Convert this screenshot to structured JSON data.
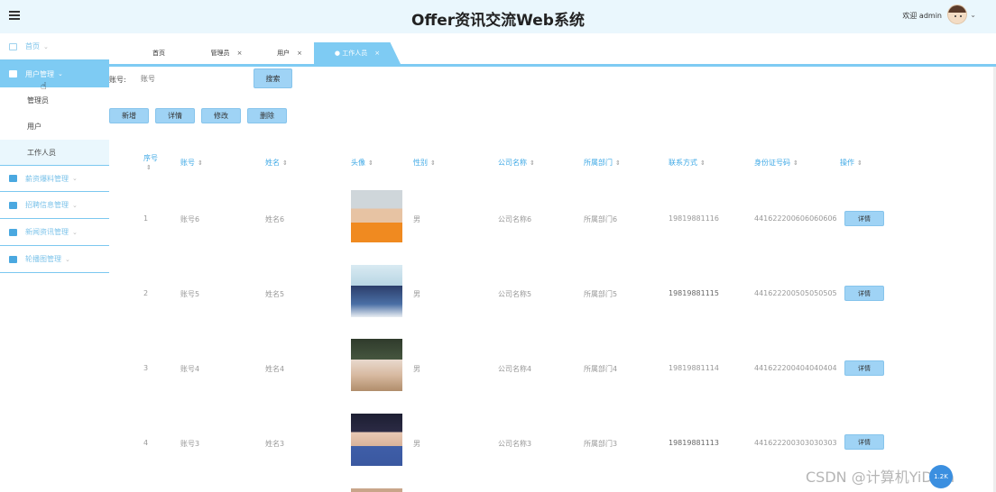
{
  "header": {
    "title": "Offer资讯交流Web系统",
    "welcome": "欢迎 admin",
    "caret": "⌄"
  },
  "sidebar": {
    "items": [
      {
        "label": "首页"
      },
      {
        "label": "用户管理"
      },
      {
        "label": "薪资爆料管理"
      },
      {
        "label": "招聘信息管理"
      },
      {
        "label": "新闻资讯管理"
      },
      {
        "label": "轮播图管理"
      }
    ],
    "sub_items": [
      {
        "label": "管理员"
      },
      {
        "label": "用户"
      },
      {
        "label": "工作人员"
      }
    ]
  },
  "tabs": [
    {
      "label": "首页",
      "close": ""
    },
    {
      "label": "管理员",
      "close": "×"
    },
    {
      "label": "用户",
      "close": "×"
    },
    {
      "label": "● 工作人员",
      "close": "×"
    }
  ],
  "search": {
    "label": "账号:",
    "placeholder": "账号",
    "button": "搜索"
  },
  "toolbar": {
    "add": "新增",
    "detail": "详情",
    "edit": "修改",
    "delete": "删除"
  },
  "table": {
    "headers": [
      "序号",
      "账号",
      "姓名",
      "头像",
      "性别",
      "公司名称",
      "所属部门",
      "联系方式",
      "身份证号码",
      "操作"
    ],
    "sort_glyph": "⇕",
    "rows": [
      {
        "no": "1",
        "account": "账号6",
        "name": "姓名6",
        "gender": "男",
        "company": "公司名称6",
        "dept": "所属部门6",
        "phone": "19819881116",
        "id_card": "441622200606060606",
        "action": "详情"
      },
      {
        "no": "2",
        "account": "账号5",
        "name": "姓名5",
        "gender": "男",
        "company": "公司名称5",
        "dept": "所属部门5",
        "phone": "19819881115",
        "id_card": "441622200505050505",
        "action": "详情"
      },
      {
        "no": "3",
        "account": "账号4",
        "name": "姓名4",
        "gender": "男",
        "company": "公司名称4",
        "dept": "所属部门4",
        "phone": "19819881114",
        "id_card": "441622200404040404",
        "action": "详情"
      },
      {
        "no": "4",
        "account": "账号3",
        "name": "姓名3",
        "gender": "男",
        "company": "公司名称3",
        "dept": "所属部门3",
        "phone": "19819881113",
        "id_card": "441622200303030303",
        "action": "详情"
      }
    ]
  },
  "watermark": "CSDN @计算机YiDian",
  "float_badge": "1.2K",
  "colors": {
    "accent": "#7ecbf3",
    "header_bg": "#eaf7fd",
    "button_bg": "#9fd3f5",
    "header_text": "#3fa9e6"
  }
}
